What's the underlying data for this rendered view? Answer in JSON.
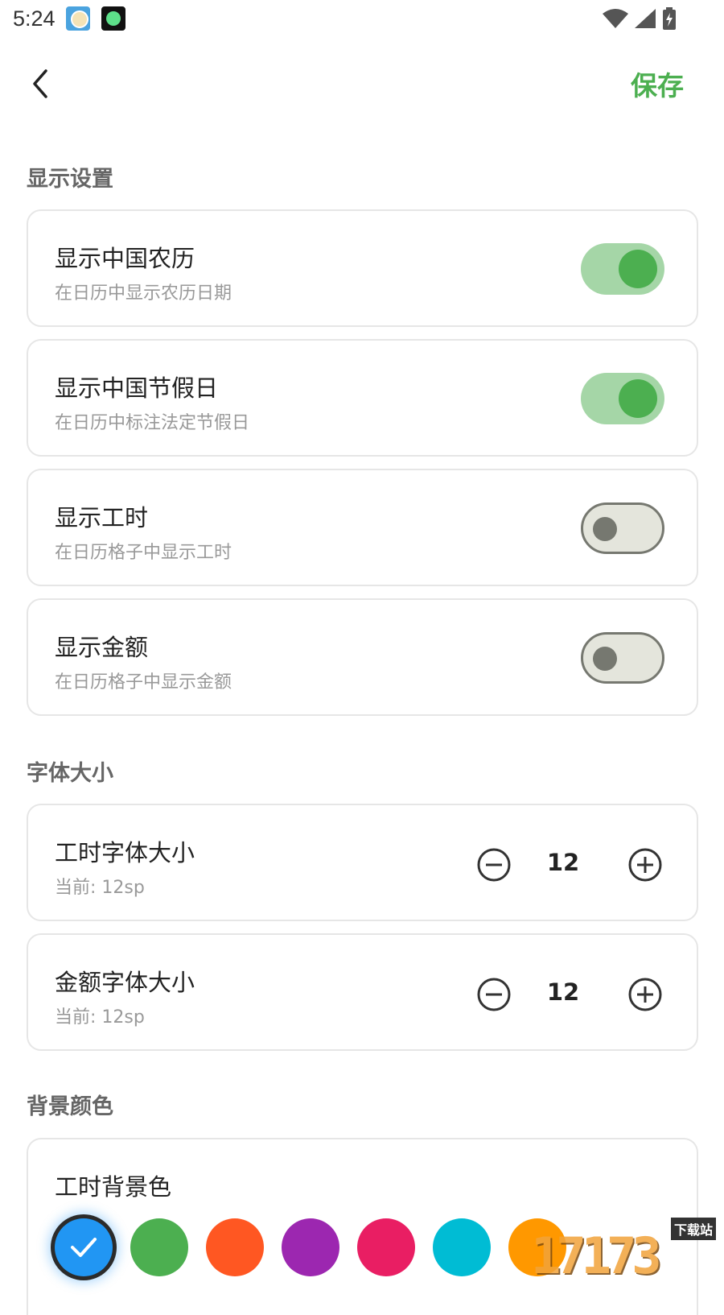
{
  "status_bar": {
    "time": "5:24",
    "icons": [
      "app-notification-icon",
      "moon-app-icon",
      "wifi-icon",
      "signal-icon",
      "battery-charging-icon"
    ]
  },
  "header": {
    "back_icon": "chevron-left-icon",
    "save_label": "保存"
  },
  "sections": {
    "display": {
      "title": "显示设置",
      "items": [
        {
          "title": "显示中国农历",
          "subtitle": "在日历中显示农历日期",
          "enabled": true
        },
        {
          "title": "显示中国节假日",
          "subtitle": "在日历中标注法定节假日",
          "enabled": true
        },
        {
          "title": "显示工时",
          "subtitle": "在日历格子中显示工时",
          "enabled": false
        },
        {
          "title": "显示金额",
          "subtitle": "在日历格子中显示金额",
          "enabled": false
        }
      ]
    },
    "font_size": {
      "title": "字体大小",
      "items": [
        {
          "title": "工时字体大小",
          "subtitle": "当前: 12sp",
          "value": "12"
        },
        {
          "title": "金额字体大小",
          "subtitle": "当前: 12sp",
          "value": "12"
        }
      ]
    },
    "background": {
      "title": "背景颜色",
      "card_title": "工时背景色",
      "swatches": [
        {
          "color": "#2196F3",
          "selected": true
        },
        {
          "color": "#4CAF50",
          "selected": false
        },
        {
          "color": "#FF5722",
          "selected": false
        },
        {
          "color": "#9C27B0",
          "selected": false
        },
        {
          "color": "#E91E63",
          "selected": false
        },
        {
          "color": "#00BCD4",
          "selected": false
        },
        {
          "color": "#FF9800",
          "selected": false
        }
      ]
    }
  },
  "watermark": {
    "text": "17173",
    "tag": "下载站"
  },
  "colors": {
    "accent": "#4CAF50",
    "toggle_on_track": "#A5D6A7",
    "toggle_off_track": "#E4E5DC"
  }
}
